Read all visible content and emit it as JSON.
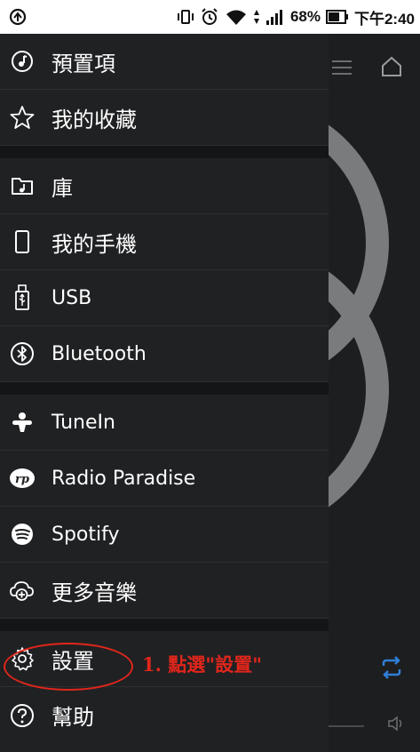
{
  "status_bar": {
    "battery": "68%",
    "time": "下午2:40",
    "icons": [
      "notification-icon",
      "vibrate-icon",
      "alarm-icon",
      "wifi-icon",
      "signal-icon",
      "battery-icon"
    ]
  },
  "drawer": {
    "sections": [
      {
        "items": [
          {
            "key": "presets",
            "label": "預置項",
            "icon": "music-note-circle-icon"
          },
          {
            "key": "favorites",
            "label": "我的收藏",
            "icon": "star-icon"
          }
        ]
      },
      {
        "items": [
          {
            "key": "library",
            "label": "庫",
            "icon": "folder-music-icon"
          },
          {
            "key": "my_phone",
            "label": "我的手機",
            "icon": "phone-icon"
          },
          {
            "key": "usb",
            "label": "USB",
            "icon": "usb-icon"
          },
          {
            "key": "bluetooth",
            "label": "Bluetooth",
            "icon": "bluetooth-icon"
          }
        ]
      },
      {
        "items": [
          {
            "key": "tunein",
            "label": "TuneIn",
            "icon": "tunein-icon"
          },
          {
            "key": "radio_paradise",
            "label": "Radio Paradise",
            "icon": "radio-paradise-icon"
          },
          {
            "key": "spotify",
            "label": "Spotify",
            "icon": "spotify-icon"
          },
          {
            "key": "more_music",
            "label": "更多音樂",
            "icon": "cloud-add-icon"
          }
        ]
      },
      {
        "items": [
          {
            "key": "settings",
            "label": "設置",
            "icon": "gear-icon"
          },
          {
            "key": "help",
            "label": "幫助",
            "icon": "help-icon"
          }
        ]
      }
    ]
  },
  "annotation": {
    "text": "1. 點選\"設置\"",
    "color": "#e0261b"
  }
}
